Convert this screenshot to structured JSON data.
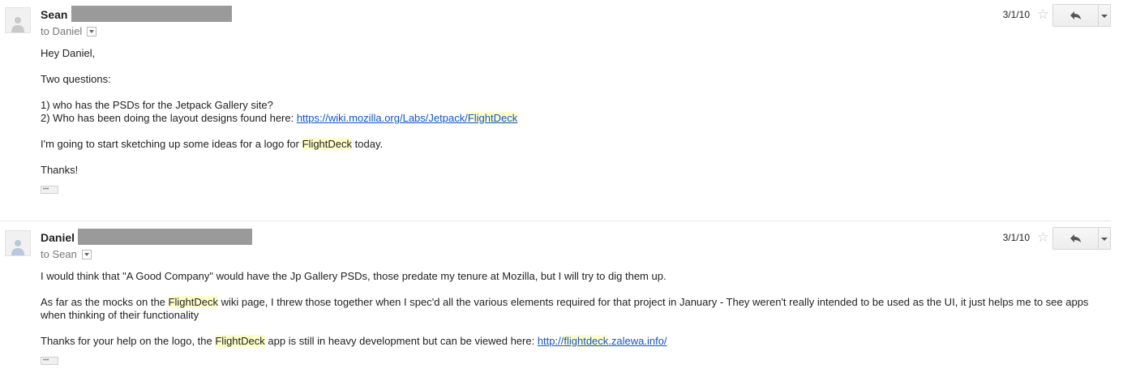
{
  "messages": [
    {
      "sender": "Sean",
      "to_label": "to Daniel",
      "date": "3/1/10",
      "greeting": "Hey Daniel,",
      "line2": "Two questions:",
      "q1": "1) who has the PSDs for the Jetpack Gallery site?",
      "q2_prefix": "2) Who has been doing the layout designs found here: ",
      "q2_link_a": "https://wiki.mozilla.org/Labs/Jetpack/",
      "q2_link_b": "FlightDeck",
      "p3_a": "I'm going to start sketching up some ideas for a logo for ",
      "p3_hl": "FlightDeck",
      "p3_b": " today.",
      "thanks": "Thanks!"
    },
    {
      "sender": "Daniel",
      "to_label": "to Sean",
      "date": "3/1/10",
      "p1": "I would think that \"A Good Company\" would have the Jp Gallery PSDs, those predate my tenure at Mozilla, but I will try to dig them up.",
      "p2_a": "As far as the mocks on the ",
      "p2_hl": "FlightDeck",
      "p2_b": " wiki page, I threw those together when I spec'd all the various elements required for that project in January - They weren't really intended to be used as the UI, it just helps me to see apps when thinking of their functionality",
      "p3_a": "Thanks for your help on the logo, the ",
      "p3_hl": "FlightDeck",
      "p3_b": " app is still in heavy development but can be viewed here: ",
      "link_a": "http://",
      "link_hl": "flightdeck",
      "link_b": ".zalewa.info/"
    }
  ],
  "icons": {
    "star": "star-icon",
    "reply": "reply-icon",
    "more": "more-options-icon",
    "avatar": "default-avatar-icon",
    "details": "show-details-icon",
    "trimmed": "show-trimmed-content-icon"
  },
  "colors": {
    "link": "#1155cc",
    "highlight": "#ffffcc",
    "redaction": "#9a9a9a"
  }
}
